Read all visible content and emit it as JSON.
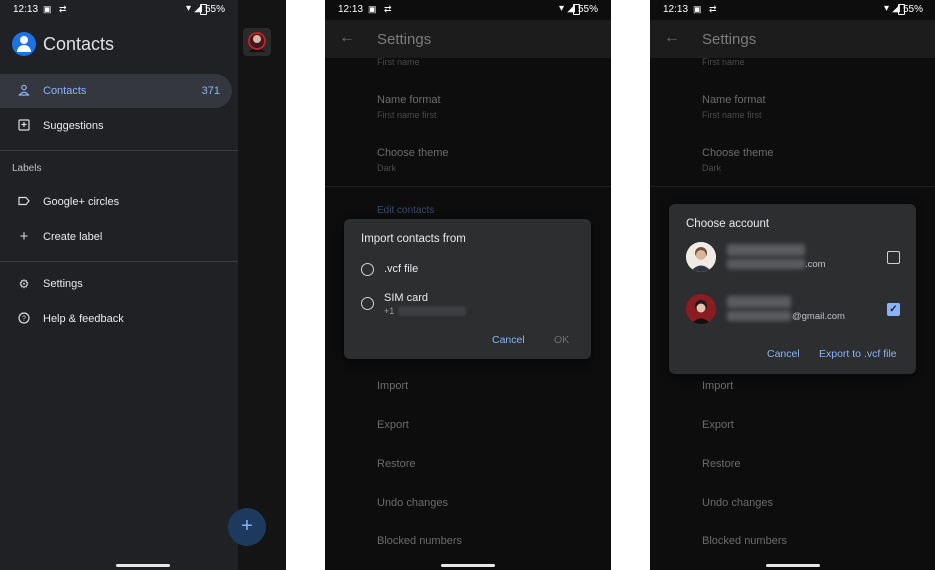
{
  "status": {
    "time": "12:13",
    "battery": "55%"
  },
  "drawer": {
    "app_title": "Contacts",
    "items": [
      {
        "label": "Contacts",
        "count": "371"
      },
      {
        "label": "Suggestions"
      }
    ],
    "labels_heading": "Labels",
    "label_items": [
      {
        "label": "Google+ circles"
      },
      {
        "label": "Create label"
      }
    ],
    "bottom_items": [
      {
        "label": "Settings"
      },
      {
        "label": "Help & feedback"
      }
    ],
    "fab_icon": "plus-icon"
  },
  "settings": {
    "title": "Settings",
    "top_partial": "First name",
    "name_format": {
      "label": "Name format",
      "value": "First name first"
    },
    "choose_theme": {
      "label": "Choose theme",
      "value": "Dark"
    },
    "edit_contacts": "Edit contacts",
    "items": [
      "Import",
      "Export",
      "Restore",
      "Undo changes",
      "Blocked numbers"
    ]
  },
  "import_dialog": {
    "title": "Import contacts from",
    "options": [
      {
        "label": ".vcf file"
      },
      {
        "label": "SIM card",
        "sub": "+1"
      }
    ],
    "cancel": "Cancel",
    "ok": "OK"
  },
  "account_dialog": {
    "title": "Choose account",
    "accounts": [
      {
        "email_suffix": ".com",
        "checked": false
      },
      {
        "email_suffix": "@gmail.com",
        "checked": true
      }
    ],
    "cancel": "Cancel",
    "export": "Export to .vcf file"
  },
  "colors": {
    "accent": "#8ab4f8",
    "brand": "#1a73e8",
    "drawer_bg": "#202124",
    "dialog_bg": "#2d2e30"
  }
}
